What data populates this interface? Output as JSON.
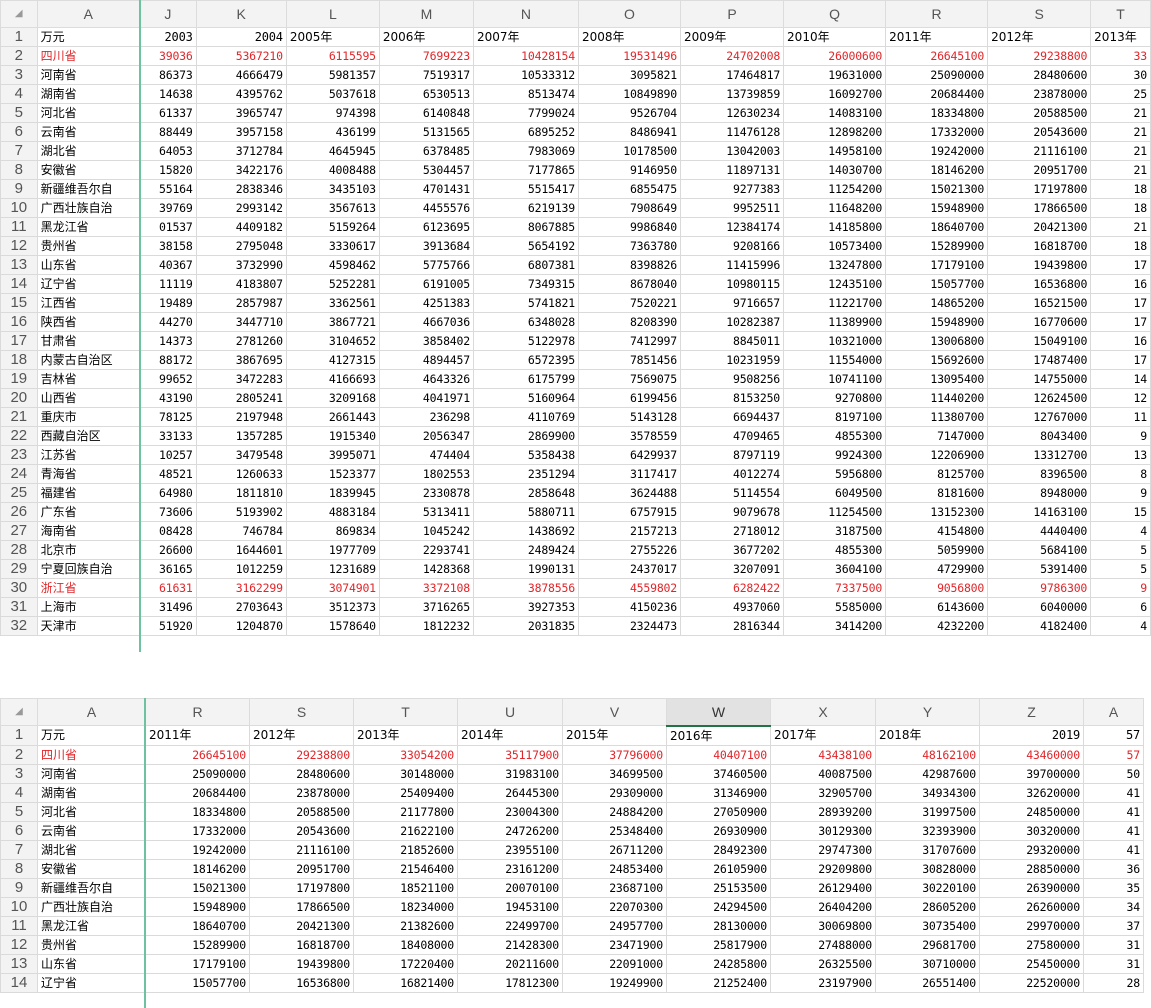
{
  "corner_icon": "select-all-triangle",
  "accent_color": "#217346",
  "highlight_color": "#e0262a",
  "sheet1": {
    "columns": [
      "A",
      "J",
      "K",
      "L",
      "M",
      "N",
      "O",
      "P",
      "Q",
      "R",
      "S",
      "T"
    ],
    "header_row": [
      "万元",
      "2003",
      "2004",
      "2005年",
      "2006年",
      "2007年",
      "2008年",
      "2009年",
      "2010年",
      "2011年",
      "2012年",
      "2013年"
    ],
    "rows": [
      {
        "n": "2",
        "cells": [
          "四川省",
          "39036",
          "5367210",
          "6115595",
          "7699223",
          "10428154",
          "19531496",
          "24702008",
          "26000600",
          "26645100",
          "29238800",
          "33"
        ],
        "red": true
      },
      {
        "n": "3",
        "cells": [
          "河南省",
          "86373",
          "4666479",
          "5981357",
          "7519317",
          "10533312",
          "3095821",
          "17464817",
          "19631000",
          "25090000",
          "28480600",
          "30"
        ],
        "red": false
      },
      {
        "n": "4",
        "cells": [
          "湖南省",
          "14638",
          "4395762",
          "5037618",
          "6530513",
          "8513474",
          "10849890",
          "13739859",
          "16092700",
          "20684400",
          "23878000",
          "25"
        ],
        "red": false
      },
      {
        "n": "5",
        "cells": [
          "河北省",
          "61337",
          "3965747",
          "974398",
          "6140848",
          "7799024",
          "9526704",
          "12630234",
          "14083100",
          "18334800",
          "20588500",
          "21"
        ],
        "red": false
      },
      {
        "n": "6",
        "cells": [
          "云南省",
          "88449",
          "3957158",
          "436199",
          "5131565",
          "6895252",
          "8486941",
          "11476128",
          "12898200",
          "17332000",
          "20543600",
          "21"
        ],
        "red": false
      },
      {
        "n": "7",
        "cells": [
          "湖北省",
          "64053",
          "3712784",
          "4645945",
          "6378485",
          "7983069",
          "10178500",
          "13042003",
          "14958100",
          "19242000",
          "21116100",
          "21"
        ],
        "red": false
      },
      {
        "n": "8",
        "cells": [
          "安徽省",
          "15820",
          "3422176",
          "4008488",
          "5304457",
          "7177865",
          "9146950",
          "11897131",
          "14030700",
          "18146200",
          "20951700",
          "21"
        ],
        "red": false
      },
      {
        "n": "9",
        "cells": [
          "新疆维吾尔自",
          "55164",
          "2838346",
          "3435103",
          "4701431",
          "5515417",
          "6855475",
          "9277383",
          "11254200",
          "15021300",
          "17197800",
          "18"
        ],
        "red": false
      },
      {
        "n": "10",
        "cells": [
          "广西壮族自治",
          "39769",
          "2993142",
          "3567613",
          "4455576",
          "6219139",
          "7908649",
          "9952511",
          "11648200",
          "15948900",
          "17866500",
          "18"
        ],
        "red": false
      },
      {
        "n": "11",
        "cells": [
          "黑龙江省",
          "01537",
          "4409182",
          "5159264",
          "6123695",
          "8067885",
          "9986840",
          "12384174",
          "14185800",
          "18640700",
          "20421300",
          "21"
        ],
        "red": false
      },
      {
        "n": "12",
        "cells": [
          "贵州省",
          "38158",
          "2795048",
          "3330617",
          "3913684",
          "5654192",
          "7363780",
          "9208166",
          "10573400",
          "15289900",
          "16818700",
          "18"
        ],
        "red": false
      },
      {
        "n": "13",
        "cells": [
          "山东省",
          "40367",
          "3732990",
          "4598462",
          "5775766",
          "6807381",
          "8398826",
          "11415996",
          "13247800",
          "17179100",
          "19439800",
          "17"
        ],
        "red": false
      },
      {
        "n": "14",
        "cells": [
          "辽宁省",
          "11119",
          "4183807",
          "5252281",
          "6191005",
          "7349315",
          "8678040",
          "10980115",
          "12435100",
          "15057700",
          "16536800",
          "16"
        ],
        "red": false
      },
      {
        "n": "15",
        "cells": [
          "江西省",
          "19489",
          "2857987",
          "3362561",
          "4251383",
          "5741821",
          "7520221",
          "9716657",
          "11221700",
          "14865200",
          "16521500",
          "17"
        ],
        "red": false
      },
      {
        "n": "16",
        "cells": [
          "陕西省",
          "44270",
          "3447710",
          "3867721",
          "4667036",
          "6348028",
          "8208390",
          "10282387",
          "11389900",
          "15948900",
          "16770600",
          "17"
        ],
        "red": false
      },
      {
        "n": "17",
        "cells": [
          "甘肃省",
          "14373",
          "2781260",
          "3104652",
          "3858402",
          "5122978",
          "7412997",
          "8845011",
          "10321000",
          "13006800",
          "15049100",
          "16"
        ],
        "red": false
      },
      {
        "n": "18",
        "cells": [
          "内蒙古自治区",
          "88172",
          "3867695",
          "4127315",
          "4894457",
          "6572395",
          "7851456",
          "10231959",
          "11554000",
          "15692600",
          "17487400",
          "17"
        ],
        "red": false
      },
      {
        "n": "19",
        "cells": [
          "吉林省",
          "99652",
          "3472283",
          "4166693",
          "4643326",
          "6175799",
          "7569075",
          "9508256",
          "10741100",
          "13095400",
          "14755000",
          "14"
        ],
        "red": false
      },
      {
        "n": "20",
        "cells": [
          "山西省",
          "43190",
          "2805241",
          "3209168",
          "4041971",
          "5160964",
          "6199456",
          "8153250",
          "9270800",
          "11440200",
          "12624500",
          "12"
        ],
        "red": false
      },
      {
        "n": "21",
        "cells": [
          "重庆市",
          "78125",
          "2197948",
          "2661443",
          "236298",
          "4110769",
          "5143128",
          "6694437",
          "8197100",
          "11380700",
          "12767000",
          "11"
        ],
        "red": false
      },
      {
        "n": "22",
        "cells": [
          "西藏自治区",
          "33133",
          "1357285",
          "1915340",
          "2056347",
          "2869900",
          "3578559",
          "4709465",
          "4855300",
          "7147000",
          "8043400",
          "9"
        ],
        "red": false
      },
      {
        "n": "23",
        "cells": [
          "江苏省",
          "10257",
          "3479548",
          "3995071",
          "474404",
          "5358438",
          "6429937",
          "8797119",
          "9924300",
          "12206900",
          "13312700",
          "13"
        ],
        "red": false
      },
      {
        "n": "24",
        "cells": [
          "青海省",
          "48521",
          "1260633",
          "1523377",
          "1802553",
          "2351294",
          "3117417",
          "4012274",
          "5956800",
          "8125700",
          "8396500",
          "8"
        ],
        "red": false
      },
      {
        "n": "25",
        "cells": [
          "福建省",
          "64980",
          "1811810",
          "1839945",
          "2330878",
          "2858648",
          "3624488",
          "5114554",
          "6049500",
          "8181600",
          "8948000",
          "9"
        ],
        "red": false
      },
      {
        "n": "26",
        "cells": [
          "广东省",
          "73606",
          "5193902",
          "4883184",
          "5313411",
          "5880711",
          "6757915",
          "9079678",
          "11254500",
          "13152300",
          "14163100",
          "15"
        ],
        "red": false
      },
      {
        "n": "27",
        "cells": [
          "海南省",
          "08428",
          "746784",
          "869834",
          "1045242",
          "1438692",
          "2157213",
          "2718012",
          "3187500",
          "4154800",
          "4440400",
          "4"
        ],
        "red": false
      },
      {
        "n": "28",
        "cells": [
          "北京市",
          "26600",
          "1644601",
          "1977709",
          "2293741",
          "2489424",
          "2755226",
          "3677202",
          "4855300",
          "5059900",
          "5684100",
          "5"
        ],
        "red": false
      },
      {
        "n": "29",
        "cells": [
          "宁夏回族自治",
          "36165",
          "1012259",
          "1231689",
          "1428368",
          "1990131",
          "2437017",
          "3207091",
          "3604100",
          "4729900",
          "5391400",
          "5"
        ],
        "red": false
      },
      {
        "n": "30",
        "cells": [
          "浙江省",
          "61631",
          "3162299",
          "3074901",
          "3372108",
          "3878556",
          "4559802",
          "6282422",
          "7337500",
          "9056800",
          "9786300",
          "9"
        ],
        "red": true
      },
      {
        "n": "31",
        "cells": [
          "上海市",
          "31496",
          "2703643",
          "3512373",
          "3716265",
          "3927353",
          "4150236",
          "4937060",
          "5585000",
          "6143600",
          "6040000",
          "6"
        ],
        "red": false
      },
      {
        "n": "32",
        "cells": [
          "天津市",
          "51920",
          "1204870",
          "1578640",
          "1812232",
          "2031835",
          "2324473",
          "2816344",
          "3414200",
          "4232200",
          "4182400",
          "4"
        ],
        "red": false
      }
    ]
  },
  "sheet2": {
    "columns": [
      "A",
      "R",
      "S",
      "T",
      "U",
      "V",
      "W",
      "X",
      "Y",
      "Z",
      "A"
    ],
    "selected_column": "W",
    "header_row": [
      "万元",
      "2011年",
      "2012年",
      "2013年",
      "2014年",
      "2015年",
      "2016年",
      "2017年",
      "2018年",
      "2019",
      "57"
    ],
    "rows": [
      {
        "n": "2",
        "cells": [
          "四川省",
          "26645100",
          "29238800",
          "33054200",
          "35117900",
          "37796000",
          "40407100",
          "43438100",
          "48162100",
          "43460000",
          "57"
        ],
        "red": true
      },
      {
        "n": "3",
        "cells": [
          "河南省",
          "25090000",
          "28480600",
          "30148000",
          "31983100",
          "34699500",
          "37460500",
          "40087500",
          "42987600",
          "39700000",
          "50"
        ],
        "red": false
      },
      {
        "n": "4",
        "cells": [
          "湖南省",
          "20684400",
          "23878000",
          "25409400",
          "26445300",
          "29309000",
          "31346900",
          "32905700",
          "34934300",
          "32620000",
          "41"
        ],
        "red": false
      },
      {
        "n": "5",
        "cells": [
          "河北省",
          "18334800",
          "20588500",
          "21177800",
          "23004300",
          "24884200",
          "27050900",
          "28939200",
          "31997500",
          "24850000",
          "41"
        ],
        "red": false
      },
      {
        "n": "6",
        "cells": [
          "云南省",
          "17332000",
          "20543600",
          "21622100",
          "24726200",
          "25348400",
          "26930900",
          "30129300",
          "32393900",
          "30320000",
          "41"
        ],
        "red": false
      },
      {
        "n": "7",
        "cells": [
          "湖北省",
          "19242000",
          "21116100",
          "21852600",
          "23955100",
          "26711200",
          "28492300",
          "29747300",
          "31707600",
          "29320000",
          "41"
        ],
        "red": false
      },
      {
        "n": "8",
        "cells": [
          "安徽省",
          "18146200",
          "20951700",
          "21546400",
          "23161200",
          "24853400",
          "26105900",
          "29209800",
          "30828000",
          "28850000",
          "36"
        ],
        "red": false
      },
      {
        "n": "9",
        "cells": [
          "新疆维吾尔自",
          "15021300",
          "17197800",
          "18521100",
          "20070100",
          "23687100",
          "25153500",
          "26129400",
          "30220100",
          "26390000",
          "35"
        ],
        "red": false
      },
      {
        "n": "10",
        "cells": [
          "广西壮族自治",
          "15948900",
          "17866500",
          "18234000",
          "19453100",
          "22070300",
          "24294500",
          "26404200",
          "28605200",
          "26260000",
          "34"
        ],
        "red": false
      },
      {
        "n": "11",
        "cells": [
          "黑龙江省",
          "18640700",
          "20421300",
          "21382600",
          "22499700",
          "24957700",
          "28130000",
          "30069800",
          "30735400",
          "29970000",
          "37"
        ],
        "red": false
      },
      {
        "n": "12",
        "cells": [
          "贵州省",
          "15289900",
          "16818700",
          "18408000",
          "21428300",
          "23471900",
          "25817900",
          "27488000",
          "29681700",
          "27580000",
          "31"
        ],
        "red": false
      },
      {
        "n": "13",
        "cells": [
          "山东省",
          "17179100",
          "19439800",
          "17220400",
          "20211600",
          "22091000",
          "24285800",
          "26325500",
          "30710000",
          "25450000",
          "31"
        ],
        "red": false
      },
      {
        "n": "14",
        "cells": [
          "辽宁省",
          "15057700",
          "16536800",
          "16821400",
          "17812300",
          "19249900",
          "21252400",
          "23197900",
          "26551400",
          "22520000",
          "28"
        ],
        "red": false
      }
    ]
  }
}
